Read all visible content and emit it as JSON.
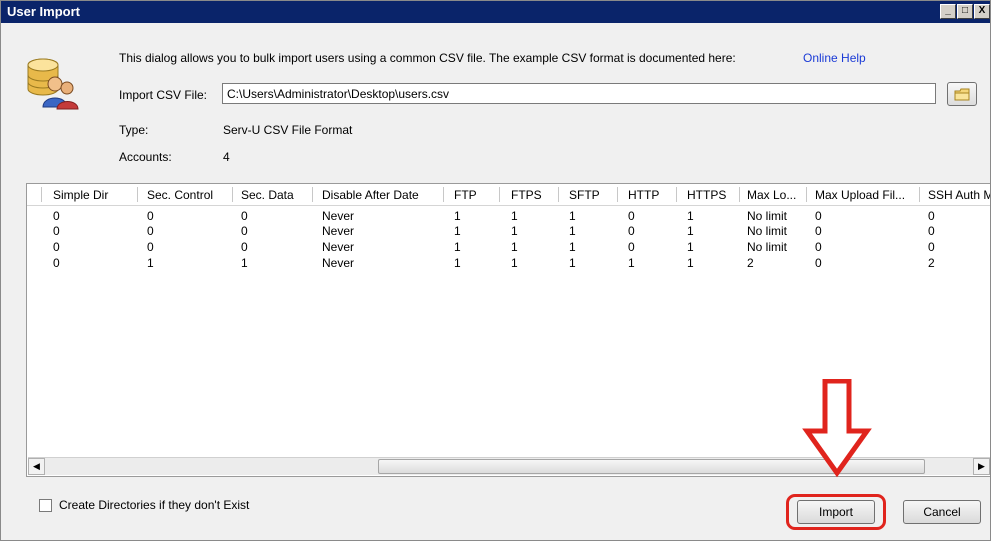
{
  "window": {
    "title": "User Import",
    "controls": [
      "_",
      "□",
      "X"
    ]
  },
  "intro": {
    "text": "This dialog allows you to bulk import users using a common CSV file.  The example CSV format is documented here:",
    "link": "Online Help"
  },
  "form": {
    "import_label": "Import CSV File:",
    "import_value": "C:\\Users\\Administrator\\Desktop\\users.csv",
    "type_label": "Type:",
    "type_value": "Serv-U CSV File Format",
    "accounts_label": "Accounts:",
    "accounts_value": "4"
  },
  "table": {
    "columns": [
      "Simple Dir",
      "Sec. Control",
      "Sec. Data",
      "Disable After Date",
      "FTP",
      "FTPS",
      "SFTP",
      "HTTP",
      "HTTPS",
      "Max Lo...",
      "Max Upload Fil...",
      "SSH Auth M"
    ],
    "rows": [
      [
        "0",
        "0",
        "0",
        "Never",
        "1",
        "1",
        "1",
        "0",
        "1",
        "No limit",
        "0",
        "0"
      ],
      [
        "0",
        "0",
        "0",
        "Never",
        "1",
        "1",
        "1",
        "0",
        "1",
        "No limit",
        "0",
        "0"
      ],
      [
        "0",
        "0",
        "0",
        "Never",
        "1",
        "1",
        "1",
        "0",
        "1",
        "No limit",
        "0",
        "0"
      ],
      [
        "0",
        "1",
        "1",
        "Never",
        "1",
        "1",
        "1",
        "1",
        "1",
        "2",
        "0",
        "2"
      ]
    ]
  },
  "footer": {
    "checkbox_label": "Create Directories if they don't Exist",
    "checkbox_checked": false,
    "import_button": "Import",
    "cancel_button": "Cancel"
  },
  "annotation_color": "#e0241d"
}
